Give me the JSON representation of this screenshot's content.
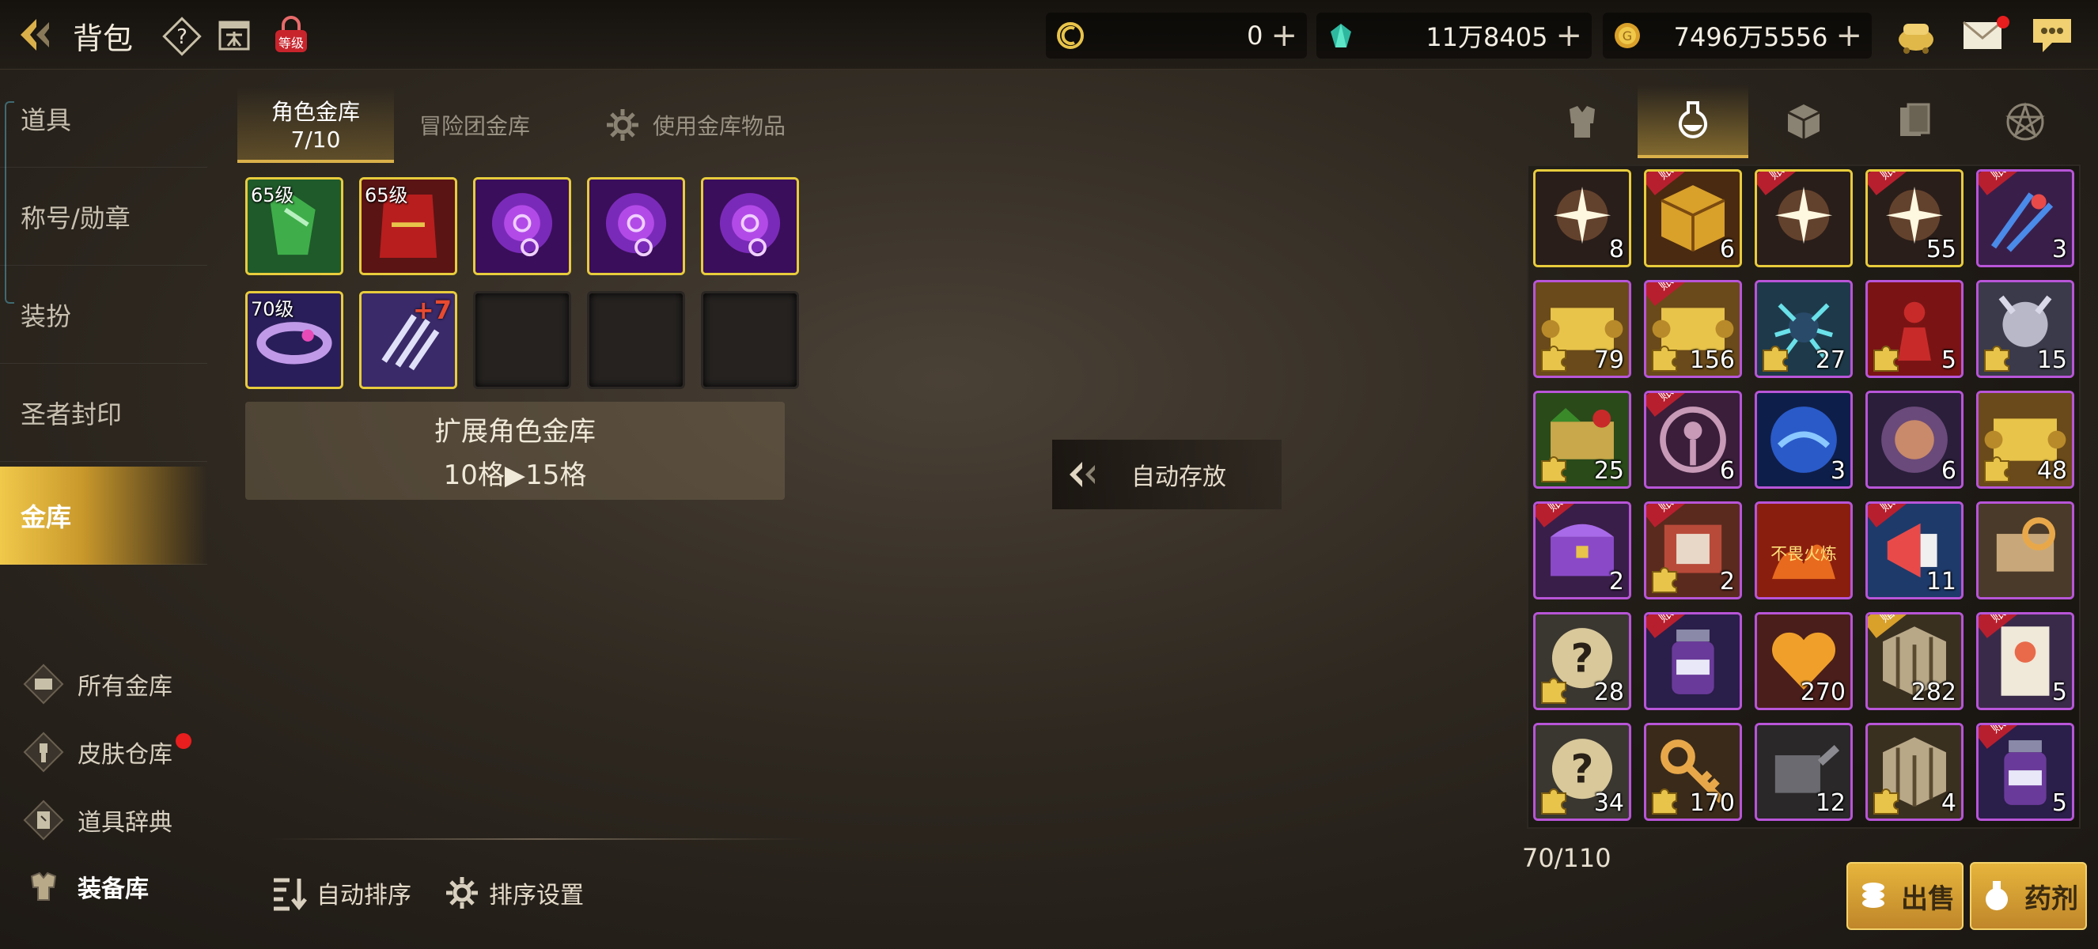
{
  "header": {
    "title": "背包",
    "level_icon_text": "等级",
    "currencies": [
      {
        "icon": "crescent-coin-icon",
        "value": "0"
      },
      {
        "icon": "teal-gem-icon",
        "value": "11万8405"
      },
      {
        "icon": "gold-coin-icon",
        "value": "7496万5556"
      }
    ]
  },
  "sidebar": {
    "items": [
      {
        "label": "道具"
      },
      {
        "label": "称号/勋章"
      },
      {
        "label": "装扮"
      },
      {
        "label": "圣者封印"
      },
      {
        "label": "金库",
        "active": true
      }
    ],
    "sub_items": [
      {
        "label": "所有金库",
        "icon": "vault-icon"
      },
      {
        "label": "皮肤仓库",
        "icon": "brush-icon",
        "badge": true
      },
      {
        "label": "道具辞典",
        "icon": "book-icon"
      },
      {
        "label": "装备库",
        "icon": "armor-icon"
      }
    ]
  },
  "vault": {
    "tabs": {
      "character": "角色金库",
      "character_count": "7/10",
      "adventure": "冒险团金库",
      "use_items": "使用金库物品"
    },
    "slots": [
      {
        "level": "65级",
        "kind": "green-armor"
      },
      {
        "level": "65级",
        "kind": "red-cloak"
      },
      {
        "kind": "purple-orb"
      },
      {
        "kind": "purple-orb"
      },
      {
        "kind": "purple-orb"
      },
      {
        "level": "70级",
        "kind": "purple-bracelet"
      },
      {
        "enhance": "+7",
        "kind": "purple-claw"
      },
      {
        "kind": "empty"
      },
      {
        "kind": "empty"
      },
      {
        "kind": "empty"
      }
    ],
    "expand_title": "扩展角色金库",
    "expand_desc": "10格▶15格",
    "auto_store": "自动存放",
    "auto_sort": "自动排序",
    "sort_settings": "排序设置"
  },
  "inventory": {
    "count": "70/110",
    "tags": {
      "account": "账号",
      "gift": "赠送"
    },
    "items": [
      {
        "count": "8",
        "border": "yellow",
        "kind": "sparkle"
      },
      {
        "count": "6",
        "border": "yellow",
        "kind": "gold-cube",
        "tag": "account"
      },
      {
        "count": "",
        "border": "yellow",
        "kind": "sparkle",
        "tag": "account"
      },
      {
        "count": "55",
        "border": "yellow",
        "kind": "sparkle",
        "tag": "account"
      },
      {
        "count": "3",
        "border": "purple",
        "kind": "claw-blue",
        "tag": "account"
      },
      {
        "count": "79",
        "border": "purple",
        "kind": "scroll",
        "puzzle": true
      },
      {
        "count": "156",
        "border": "purple",
        "kind": "scroll",
        "puzzle": true,
        "tag": "account"
      },
      {
        "count": "27",
        "border": "purple",
        "kind": "spider",
        "puzzle": true
      },
      {
        "count": "5",
        "border": "purple",
        "kind": "red-figure",
        "puzzle": true
      },
      {
        "count": "15",
        "border": "purple",
        "kind": "silver-beast",
        "puzzle": true
      },
      {
        "count": "25",
        "border": "purple",
        "kind": "green-scroll",
        "puzzle": true
      },
      {
        "count": "6",
        "border": "purple",
        "kind": "emblem",
        "tag": "account"
      },
      {
        "count": "3",
        "border": "purple",
        "kind": "blue-orb"
      },
      {
        "count": "6",
        "border": "purple",
        "kind": "beast-orb"
      },
      {
        "count": "48",
        "border": "purple",
        "kind": "scroll",
        "puzzle": true
      },
      {
        "count": "2",
        "border": "purple",
        "kind": "purple-chest",
        "tag": "account"
      },
      {
        "count": "2",
        "border": "purple",
        "kind": "book",
        "puzzle": true,
        "tag": "account"
      },
      {
        "count": "",
        "border": "purple",
        "kind": "fire-banner",
        "label": "不畏火炼"
      },
      {
        "count": "11",
        "border": "purple",
        "kind": "megaphone",
        "tag": "account"
      },
      {
        "count": "",
        "border": "purple",
        "kind": "gear-scroll"
      },
      {
        "count": "28",
        "border": "purple",
        "kind": "question",
        "puzzle": true
      },
      {
        "count": "",
        "border": "purple",
        "kind": "potion",
        "tag": "account"
      },
      {
        "count": "270",
        "border": "purple",
        "kind": "heart"
      },
      {
        "count": "282",
        "border": "purple",
        "kind": "cage",
        "tag": "gift"
      },
      {
        "count": "5",
        "border": "purple",
        "kind": "character-card",
        "tag": "account"
      },
      {
        "count": "34",
        "border": "purple",
        "kind": "question",
        "puzzle": true
      },
      {
        "count": "170",
        "border": "purple",
        "kind": "key",
        "puzzle": true
      },
      {
        "count": "12",
        "border": "purple",
        "kind": "machine"
      },
      {
        "count": "4",
        "border": "purple",
        "kind": "cage",
        "puzzle": true
      },
      {
        "count": "5",
        "border": "purple",
        "kind": "potion",
        "tag": "account"
      }
    ],
    "sell_label": "出售",
    "potion_label": "药剂"
  },
  "colors": {
    "gold_accent": "#d9b04a",
    "purple_border": "#b855d8",
    "yellow_border": "#e8cc3c",
    "account_tag": "#b81f2e"
  }
}
